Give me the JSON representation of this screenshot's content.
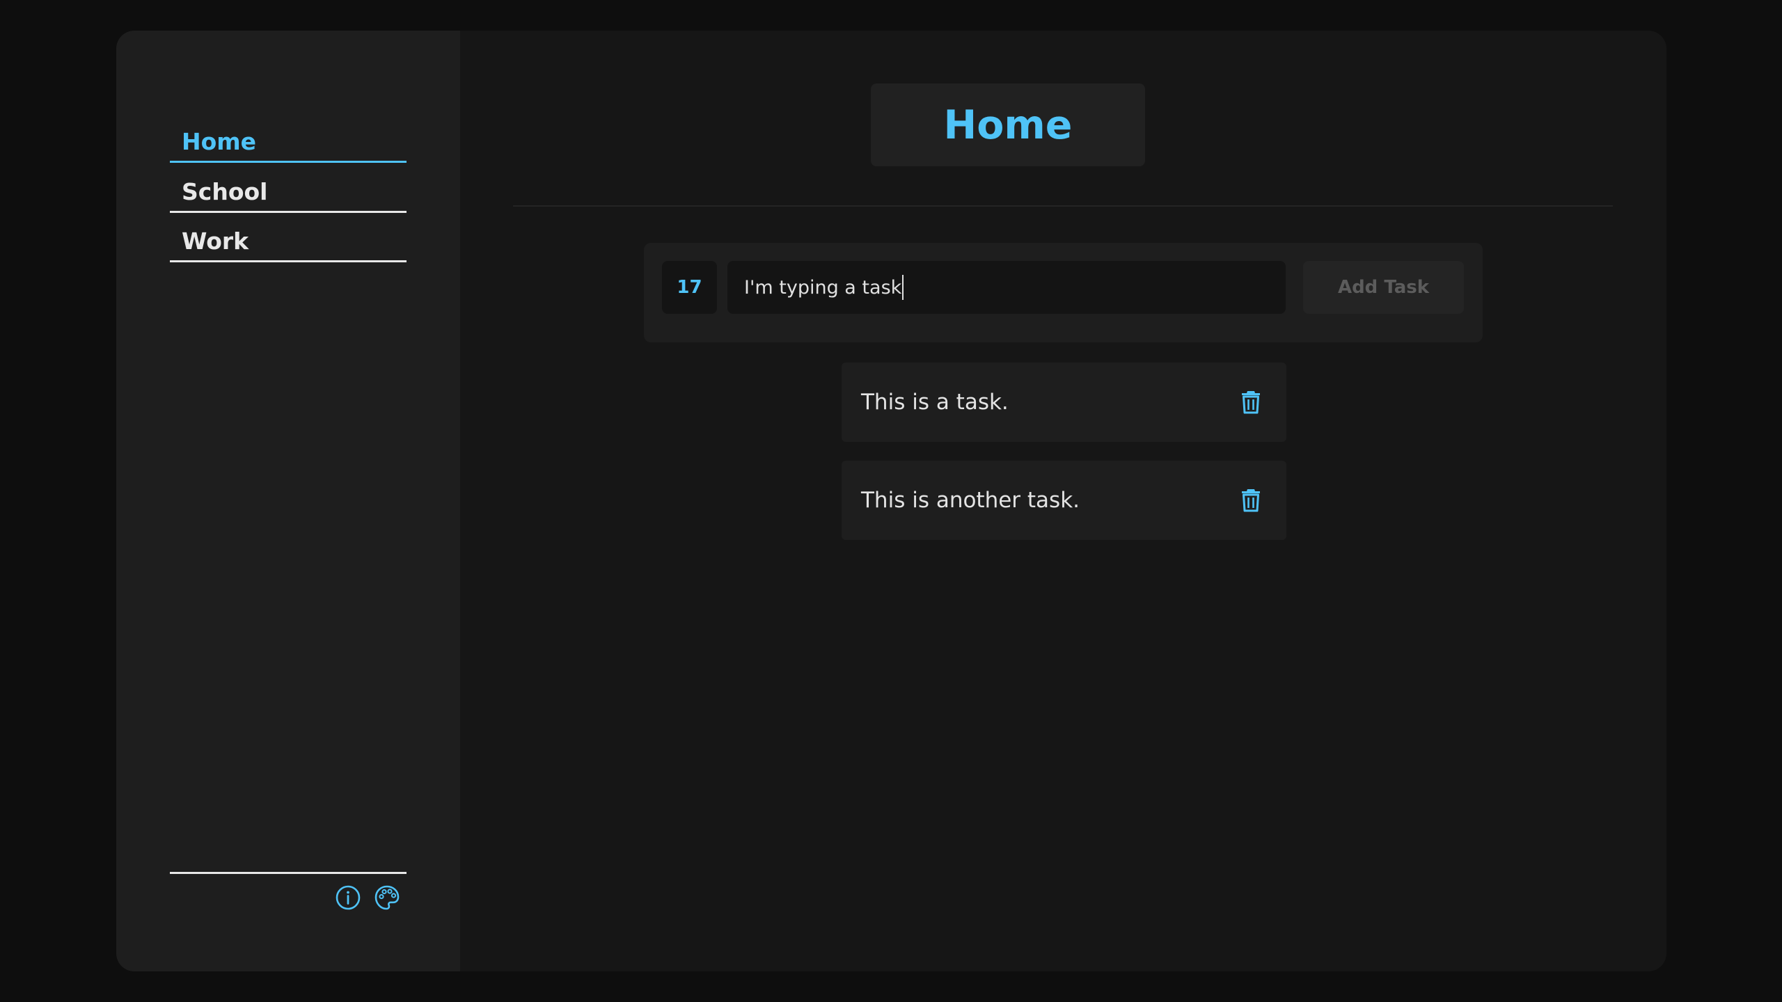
{
  "sidebar": {
    "items": [
      {
        "label": "Home",
        "active": true
      },
      {
        "label": "School",
        "active": false
      },
      {
        "label": "Work",
        "active": false
      }
    ],
    "footer_icons": [
      "info-icon",
      "palette-icon"
    ]
  },
  "main": {
    "title": "Home",
    "form": {
      "counter": "17",
      "input_value": "I'm typing a task",
      "add_button_label": "Add Task"
    },
    "tasks": [
      {
        "text": "This is a task."
      },
      {
        "text": "This is another task."
      }
    ]
  },
  "colors": {
    "accent": "#4fc3f7",
    "background": "#0e0e0e",
    "panel": "#161616",
    "sidebar": "#1e1e1e",
    "text": "#e8e8e8"
  }
}
